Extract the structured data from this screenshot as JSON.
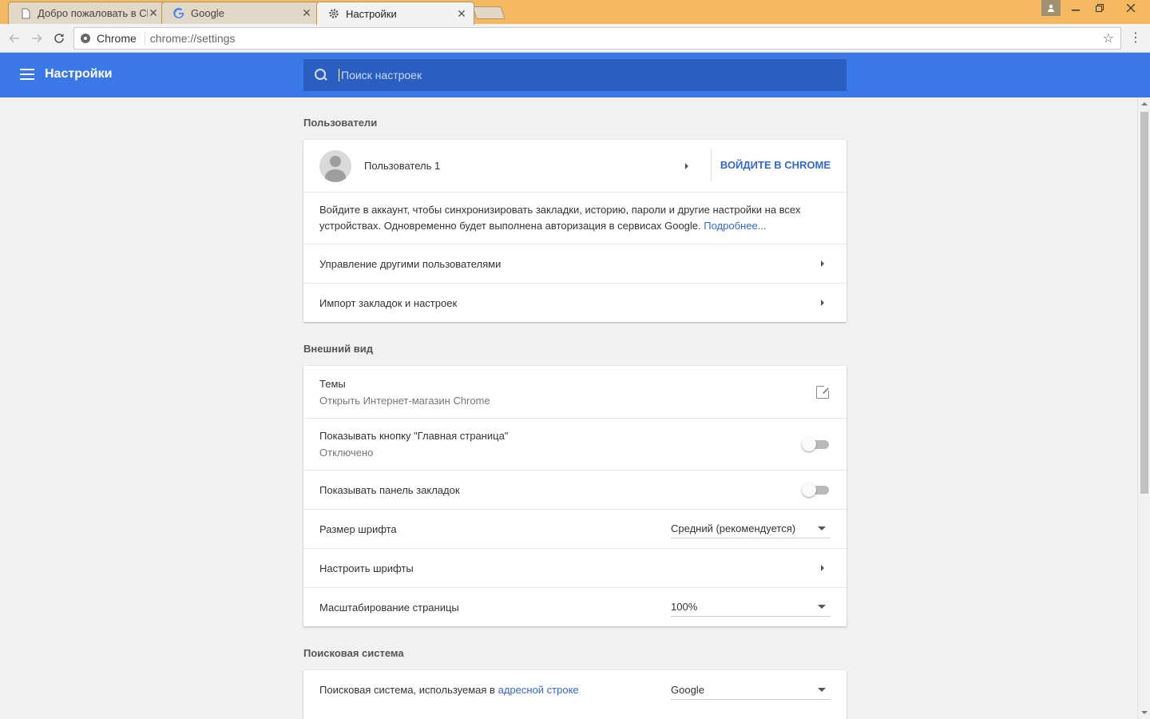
{
  "tabs": [
    {
      "title": "Добро пожаловать в Ch",
      "icon": "page-icon",
      "active": false
    },
    {
      "title": "Google",
      "icon": "google-icon",
      "active": false
    },
    {
      "title": "Настройки",
      "icon": "gear-icon",
      "active": true
    }
  ],
  "omnibox": {
    "chip": "Chrome",
    "url": "chrome://settings"
  },
  "header": {
    "title": "Настройки",
    "search_placeholder": "Поиск настроек"
  },
  "users": {
    "section_title": "Пользователи",
    "user_name": "Пользователь 1",
    "signin_label": "ВОЙДИТЕ В CHROME",
    "signin_text": "Войдите в аккаунт, чтобы синхронизировать закладки, историю, пароли и другие настройки на всех устройствах. Одновременно будет выполнена авторизация в сервисах Google.",
    "learn_more": "Подробнее...",
    "manage_users": "Управление другими пользователями",
    "import": "Импорт закладок и настроек"
  },
  "appearance": {
    "section_title": "Внешний вид",
    "themes_label": "Темы",
    "themes_sub": "Открыть Интернет-магазин Chrome",
    "home_button_label": "Показывать кнопку \"Главная страница\"",
    "home_button_sub": "Отключено",
    "bookmarks_bar_label": "Показывать панель закладок",
    "font_size_label": "Размер шрифта",
    "font_size_value": "Средний (рекомендуется)",
    "customize_fonts": "Настроить шрифты",
    "zoom_label": "Масштабирование страницы",
    "zoom_value": "100%"
  },
  "search": {
    "section_title": "Поисковая система",
    "engine_label_prefix": "Поисковая система, используемая в",
    "engine_label_link": "адресной строке",
    "engine_value": "Google"
  },
  "colors": {
    "accent": "#3b78e7",
    "link": "#3367d6",
    "titlebar": "#f4b860"
  }
}
